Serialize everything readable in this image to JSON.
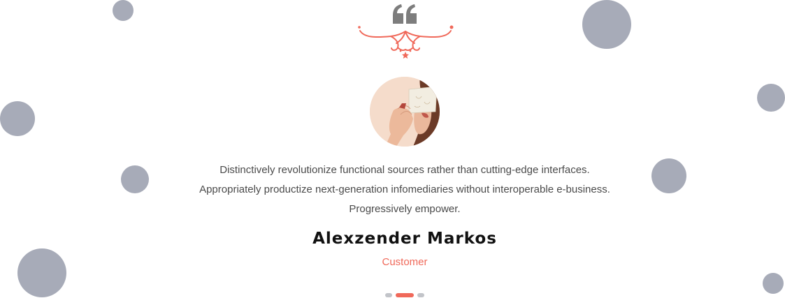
{
  "testimonial": {
    "text": "Distinctively revolutionize functional sources rather than cutting-edge interfaces. Appropriately productize next-generation infomediaries without interoperable e-business. Progressively empower.",
    "name": "Alexzender Markos",
    "role": "Customer"
  },
  "slider": {
    "active_index": 1,
    "count": 3
  },
  "colors": {
    "accent": "#f0695a",
    "bubble": "#a7abb8",
    "quote_icon": "#7d7d7d",
    "dot_inactive": "#c2c4c9"
  },
  "icons": {
    "quote": "quote-icon",
    "ornament": "ornament-divider-icon"
  }
}
